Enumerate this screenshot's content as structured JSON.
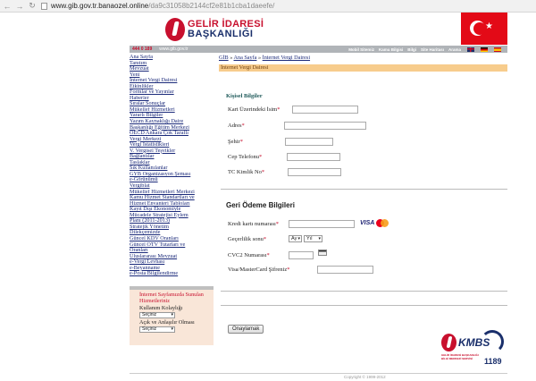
{
  "browser": {
    "url_host": "www.gib.gov.tr.banaozel.online",
    "url_path": "/da9c31058b2144cf2e81b1cba1daeefe/"
  },
  "header": {
    "logo_line1": "GELİR İDARESİ",
    "logo_line2": "BAŞKANLIĞI",
    "hotline": "444 0 189",
    "site_url": "www.gib.gov.tr",
    "top_links": [
      "Mobil Sitemiz",
      "Kamu Bilgisi",
      "Bilgi",
      "Site Haritası",
      "Arama"
    ]
  },
  "sidebar": {
    "links": [
      "Ana Sayfa",
      "Tanıtım",
      "Mevzuat",
      "Yeni",
      "İnternet Vergi Dairesi",
      "Etkinlikler",
      "Formlar ve Yayınlar",
      "Haberler",
      "Sıralar Sonuçlar",
      "Mükellef Hizmetleri",
      "Yararlı Bilgiler",
      "Yazım Kaynaklığı Daire",
      "Başkanlığı Eğitim Merkezi",
      "OECD Ankara Çok Taraflı",
      "Vergi Merkezi",
      "Vergi İstatistikleri",
      "V. Vergisel Teşvikler",
      "Bağlantılar",
      "Taslaklar",
      "Sık Kullanılanlar",
      "GYB Organizasyon Şeması",
      "e-Görünümü",
      "Vergiblat",
      "Mükellef Hizmetleri Merkezi",
      "Kamu Hizmet Standartları ve",
      "Hizmet Envanteri Tabloları",
      "Kayıt Dışı Ekonomiyle",
      "Mücadele Stratejisi Eylem",
      "Planı (2011-2013)",
      "Stratejik Yönetim",
      "Dilekçemizde",
      "Güncel KDV Oranları",
      "Güncel ÖTV Tutarları ve",
      "Oranları",
      "Uluslararası Mevzuat",
      "e-Vergi Levhası",
      "e-Beyanname",
      "e-Posta Bilgilendirme"
    ]
  },
  "survey": {
    "title": "İnternet Sayfamızda Sunulan Hizmetleriniz",
    "q1": "Kullanım Kolaylığı",
    "q1_value": "Seçiniz",
    "q2": "Açık ve Anlaşılır Olması",
    "q2_value": "Seçiniz"
  },
  "main": {
    "breadcrumb_home": "GİB",
    "breadcrumb_sep": " » ",
    "breadcrumb_1": "Ana Sayfa",
    "breadcrumb_2": "İnternet Vergi Dairesi",
    "page_title": "İnternet Vergi Dairesi",
    "section1_title": "Kişisel Bilgiler",
    "fields": {
      "card_name": "Kart Üzerindeki İsim",
      "address": "Adres",
      "city": "Şehir",
      "phone": "Cep Telefonu",
      "tc_id": "TC Kimlik No"
    },
    "section2_title": "Geri Ödeme Bilgileri",
    "payment": {
      "card_number": "Kredi kartı numarası",
      "expiry": "Geçerlilik sonu",
      "expiry_month": "Ay",
      "expiry_year": "Yıl",
      "cvc": "CVC2 Numarası",
      "password": "Visa/MasterCard Şifreniz",
      "visa": "VISA"
    },
    "required_mark": "*",
    "submit_label": "Onaylamak"
  },
  "kmbs": {
    "name": "KMBS",
    "subtitle": "GELİR İDARESİ BAŞKANLIĞI BİLGİ MERKEZİ SERVİSİ",
    "number": "1189"
  },
  "footer": {
    "copyright": "Copyright © 1999-2012"
  }
}
